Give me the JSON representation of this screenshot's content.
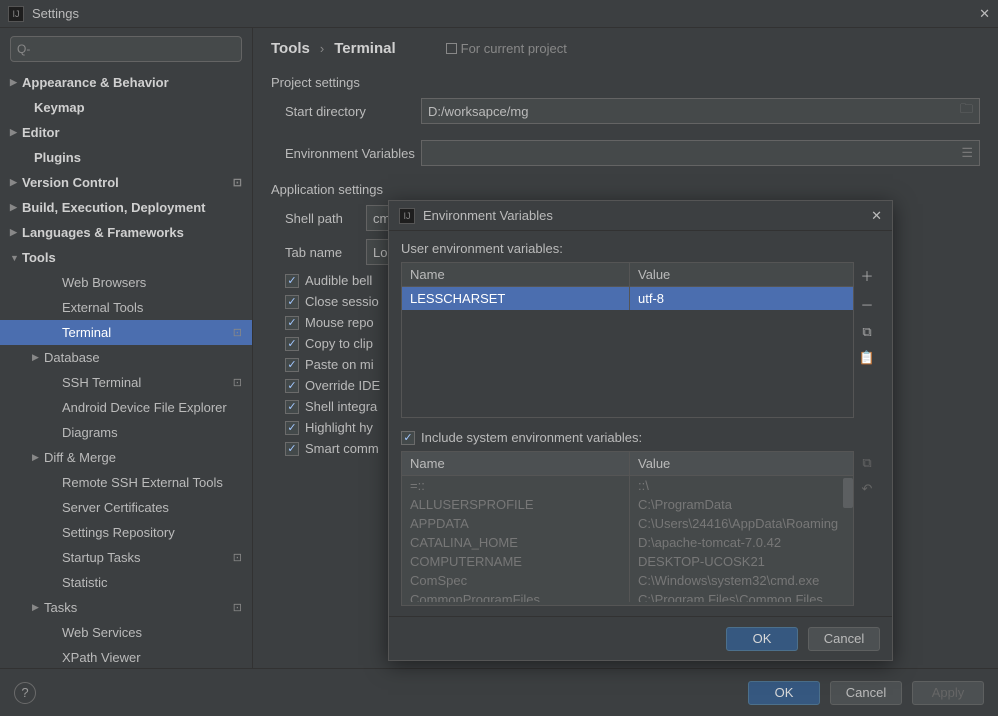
{
  "title": "Settings",
  "search_placeholder": "Q-",
  "breadcrumb": {
    "root": "Tools",
    "leaf": "Terminal",
    "scope": "For current project"
  },
  "sidebar": {
    "items": [
      {
        "label": "Appearance & Behavior",
        "bold": true,
        "arrow": true,
        "indent": 0
      },
      {
        "label": "Keymap",
        "bold": true,
        "indent": 0,
        "pad": true
      },
      {
        "label": "Editor",
        "bold": true,
        "arrow": true,
        "indent": 0
      },
      {
        "label": "Plugins",
        "bold": true,
        "indent": 0,
        "pad": true
      },
      {
        "label": "Version Control",
        "bold": true,
        "arrow": true,
        "indent": 0,
        "badge": true
      },
      {
        "label": "Build, Execution, Deployment",
        "bold": true,
        "arrow": true,
        "indent": 0
      },
      {
        "label": "Languages & Frameworks",
        "bold": true,
        "arrow": true,
        "indent": 0
      },
      {
        "label": "Tools",
        "bold": true,
        "arrow": true,
        "indent": 0,
        "open": true
      },
      {
        "label": "Web Browsers",
        "indent": 2
      },
      {
        "label": "External Tools",
        "indent": 2
      },
      {
        "label": "Terminal",
        "indent": 2,
        "selected": true,
        "badge": true
      },
      {
        "label": "Database",
        "arrow": true,
        "indent": 1
      },
      {
        "label": "SSH Terminal",
        "indent": 2,
        "badge": true
      },
      {
        "label": "Android Device File Explorer",
        "indent": 2
      },
      {
        "label": "Diagrams",
        "indent": 2
      },
      {
        "label": "Diff & Merge",
        "arrow": true,
        "indent": 1
      },
      {
        "label": "Remote SSH External Tools",
        "indent": 2
      },
      {
        "label": "Server Certificates",
        "indent": 2
      },
      {
        "label": "Settings Repository",
        "indent": 2
      },
      {
        "label": "Startup Tasks",
        "indent": 2,
        "badge": true
      },
      {
        "label": "Statistic",
        "indent": 2
      },
      {
        "label": "Tasks",
        "arrow": true,
        "indent": 1,
        "badge": true
      },
      {
        "label": "Web Services",
        "indent": 2
      },
      {
        "label": "XPath Viewer",
        "indent": 2
      }
    ]
  },
  "form": {
    "project_section": "Project settings",
    "start_dir_label": "Start directory",
    "start_dir_value": "D:/worksapce/mg",
    "env_var_label": "Environment Variables",
    "env_var_value": "",
    "app_section": "Application settings",
    "shell_path_label": "Shell path",
    "shell_path_value": "cm",
    "tab_name_label": "Tab name",
    "tab_name_value": "Lo",
    "checks": [
      "Audible bell",
      "Close sessio",
      "Mouse repo",
      "Copy to clip",
      "Paste on mi",
      "Override IDE",
      "Shell integra",
      "Highlight hy",
      "Smart comm"
    ]
  },
  "buttons": {
    "ok": "OK",
    "cancel": "Cancel",
    "apply": "Apply"
  },
  "modal": {
    "title": "Environment Variables",
    "user_desc": "User environment variables:",
    "headers": {
      "name": "Name",
      "value": "Value"
    },
    "user_rows": [
      {
        "name": "LESSCHARSET",
        "value": "utf-8"
      }
    ],
    "include_label": "Include system environment variables:",
    "sys_rows": [
      {
        "name": "=::",
        "value": "::\\"
      },
      {
        "name": "ALLUSERSPROFILE",
        "value": "C:\\ProgramData"
      },
      {
        "name": "APPDATA",
        "value": "C:\\Users\\24416\\AppData\\Roaming"
      },
      {
        "name": "CATALINA_HOME",
        "value": "D:\\apache-tomcat-7.0.42"
      },
      {
        "name": "COMPUTERNAME",
        "value": "DESKTOP-UCOSK21"
      },
      {
        "name": "ComSpec",
        "value": "C:\\Windows\\system32\\cmd.exe"
      },
      {
        "name": "CommonProgramFiles",
        "value": "C:\\Program Files\\Common Files"
      }
    ],
    "ok": "OK",
    "cancel": "Cancel"
  }
}
